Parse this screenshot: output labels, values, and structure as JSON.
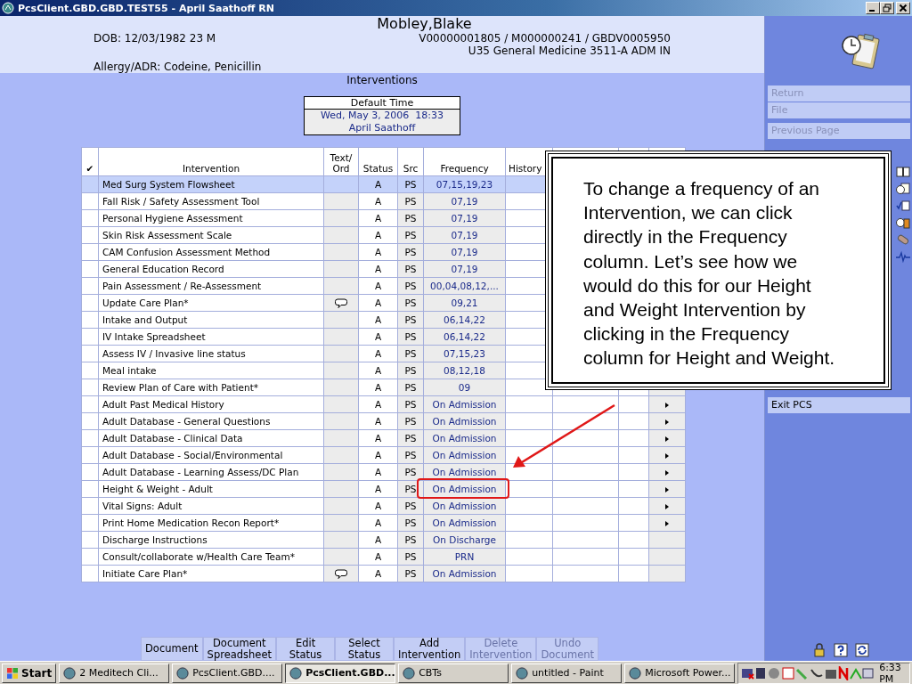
{
  "window": {
    "title": "PcsClient.GBD.GBD.TEST55 - April Saathoff RN"
  },
  "patient": {
    "name": "Mobley,Blake",
    "dob": "DOB: 12/03/1982 23 M",
    "ids": "V00000001805 / M000000241 / GBDV0005950",
    "location": "U35 General Medicine  3511-A  ADM IN",
    "allergy": "Allergy/ADR: Codeine, Penicillin"
  },
  "page_title": "Interventions",
  "default_time": {
    "label": "Default Time",
    "datetime": "Wed, May 3, 2006  18:33",
    "user": "April Saathoff"
  },
  "table": {
    "columns": [
      "✔",
      "Intervention",
      "Text/\nOrd",
      "Status",
      "Src",
      "Frequency",
      "History"
    ],
    "rows": [
      {
        "intervention": "Med Surg System Flowsheet",
        "note": false,
        "status": "A",
        "src": "PS",
        "frequency": "07,15,19,23",
        "arrow": false,
        "selected": true,
        "circled": false
      },
      {
        "intervention": "Fall Risk / Safety Assessment Tool",
        "note": false,
        "status": "A",
        "src": "PS",
        "frequency": "07,19",
        "arrow": false,
        "selected": false,
        "circled": false
      },
      {
        "intervention": "Personal Hygiene Assessment",
        "note": false,
        "status": "A",
        "src": "PS",
        "frequency": "07,19",
        "arrow": false,
        "selected": false,
        "circled": false
      },
      {
        "intervention": "Skin Risk Assessment Scale",
        "note": false,
        "status": "A",
        "src": "PS",
        "frequency": "07,19",
        "arrow": false,
        "selected": false,
        "circled": false
      },
      {
        "intervention": "CAM Confusion Assessment Method",
        "note": false,
        "status": "A",
        "src": "PS",
        "frequency": "07,19",
        "arrow": false,
        "selected": false,
        "circled": false
      },
      {
        "intervention": "General Education Record",
        "note": false,
        "status": "A",
        "src": "PS",
        "frequency": "07,19",
        "arrow": false,
        "selected": false,
        "circled": false
      },
      {
        "intervention": "Pain Assessment / Re-Assessment",
        "note": false,
        "status": "A",
        "src": "PS",
        "frequency": "00,04,08,12,...",
        "arrow": false,
        "selected": false,
        "circled": false
      },
      {
        "intervention": "Update Care Plan*",
        "note": true,
        "status": "A",
        "src": "PS",
        "frequency": "09,21",
        "arrow": false,
        "selected": false,
        "circled": false
      },
      {
        "intervention": "Intake and Output",
        "note": false,
        "status": "A",
        "src": "PS",
        "frequency": "06,14,22",
        "arrow": false,
        "selected": false,
        "circled": false
      },
      {
        "intervention": "IV Intake Spreadsheet",
        "note": false,
        "status": "A",
        "src": "PS",
        "frequency": "06,14,22",
        "arrow": false,
        "selected": false,
        "circled": false
      },
      {
        "intervention": "Assess IV / Invasive line status",
        "note": false,
        "status": "A",
        "src": "PS",
        "frequency": "07,15,23",
        "arrow": false,
        "selected": false,
        "circled": false
      },
      {
        "intervention": "Meal intake",
        "note": false,
        "status": "A",
        "src": "PS",
        "frequency": "08,12,18",
        "arrow": false,
        "selected": false,
        "circled": false
      },
      {
        "intervention": "Review Plan of Care with Patient*",
        "note": false,
        "status": "A",
        "src": "PS",
        "frequency": "09",
        "arrow": false,
        "selected": false,
        "circled": false
      },
      {
        "intervention": "Adult Past Medical History",
        "note": false,
        "status": "A",
        "src": "PS",
        "frequency": "On Admission",
        "arrow": true,
        "selected": false,
        "circled": false
      },
      {
        "intervention": "Adult Database - General Questions",
        "note": false,
        "status": "A",
        "src": "PS",
        "frequency": "On Admission",
        "arrow": true,
        "selected": false,
        "circled": false
      },
      {
        "intervention": "Adult Database - Clinical Data",
        "note": false,
        "status": "A",
        "src": "PS",
        "frequency": "On Admission",
        "arrow": true,
        "selected": false,
        "circled": false
      },
      {
        "intervention": "Adult Database - Social/Environmental",
        "note": false,
        "status": "A",
        "src": "PS",
        "frequency": "On Admission",
        "arrow": true,
        "selected": false,
        "circled": false
      },
      {
        "intervention": "Adult Database - Learning Assess/DC Plan",
        "note": false,
        "status": "A",
        "src": "PS",
        "frequency": "On Admission",
        "arrow": true,
        "selected": false,
        "circled": false
      },
      {
        "intervention": "Height & Weight - Adult",
        "note": false,
        "status": "A",
        "src": "PS",
        "frequency": "On Admission",
        "arrow": true,
        "selected": false,
        "circled": true
      },
      {
        "intervention": "Vital Signs: Adult",
        "note": false,
        "status": "A",
        "src": "PS",
        "frequency": "On Admission",
        "arrow": true,
        "selected": false,
        "circled": false
      },
      {
        "intervention": "Print Home Medication Recon Report*",
        "note": false,
        "status": "A",
        "src": "PS",
        "frequency": "On Admission",
        "arrow": true,
        "selected": false,
        "circled": false
      },
      {
        "intervention": "Discharge Instructions",
        "note": false,
        "status": "A",
        "src": "PS",
        "frequency": "On Discharge",
        "arrow": false,
        "selected": false,
        "circled": false
      },
      {
        "intervention": "Consult/collaborate w/Health Care Team*",
        "note": false,
        "status": "A",
        "src": "PS",
        "frequency": "PRN",
        "arrow": false,
        "selected": false,
        "circled": false
      },
      {
        "intervention": "Initiate Care Plan*",
        "note": true,
        "status": "A",
        "src": "PS",
        "frequency": "On Admission",
        "arrow": false,
        "selected": false,
        "circled": false
      }
    ]
  },
  "actions": [
    {
      "label": "Document",
      "disabled": false
    },
    {
      "label": "Document\nSpreadsheet",
      "disabled": false
    },
    {
      "label": "Edit\nStatus",
      "disabled": false
    },
    {
      "label": "Select\nStatus",
      "disabled": false
    },
    {
      "label": "Add\nIntervention",
      "disabled": false
    },
    {
      "label": "Delete\nIntervention",
      "disabled": true
    },
    {
      "label": "Undo\nDocument",
      "disabled": true
    }
  ],
  "sidebar": {
    "items": [
      {
        "label": "Return",
        "disabled": true
      },
      {
        "label": "File",
        "disabled": true
      },
      {
        "label": "Previous Page",
        "disabled": true
      },
      {
        "label": "Exit PCS",
        "disabled": false
      }
    ]
  },
  "callout": {
    "text": "To change a frequency of an Intervention, we can click directly in the Frequency column. Let’s see how we would do this for our Height and Weight Intervention by clicking in the Frequency column for Height and Weight."
  },
  "taskbar": {
    "start": "Start",
    "tasks": [
      {
        "label": "2 Meditech Cli...",
        "selected": false
      },
      {
        "label": "PcsClient.GBD....",
        "selected": false
      },
      {
        "label": "PcsClient.GBD...",
        "selected": true
      },
      {
        "label": "CBTs",
        "selected": false
      },
      {
        "label": "untitled - Paint",
        "selected": false
      },
      {
        "label": "Microsoft Power...",
        "selected": false
      }
    ],
    "clock": "6:33 PM"
  }
}
